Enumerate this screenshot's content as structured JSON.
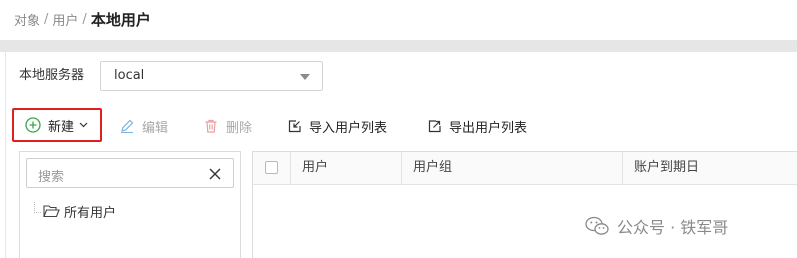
{
  "breadcrumb": {
    "items": [
      "对象",
      "用户"
    ],
    "separator": "/",
    "current": "本地用户"
  },
  "server": {
    "label": "本地服务器",
    "selected": "local"
  },
  "toolbar": {
    "new_label": "新建",
    "edit_label": "编辑",
    "delete_label": "删除",
    "import_label": "导入用户列表",
    "export_label": "导出用户列表"
  },
  "tree": {
    "search_placeholder": "搜索",
    "root_label": "所有用户"
  },
  "table": {
    "columns": [
      "用户",
      "用户组",
      "账户到期日"
    ]
  },
  "watermark": {
    "text": "公众号 · 铁军哥"
  },
  "colors": {
    "highlight_border": "#e02020",
    "new_icon": "#3aa44a",
    "disabled_text": "#a8a8a8"
  },
  "icons": {
    "new": "plus-circle-icon",
    "edit": "pencil-icon",
    "delete": "trash-icon",
    "import": "import-icon",
    "export": "export-icon",
    "search_clear": "close-icon",
    "tree_root": "folder-open-icon",
    "watermark": "wechat-icon"
  }
}
